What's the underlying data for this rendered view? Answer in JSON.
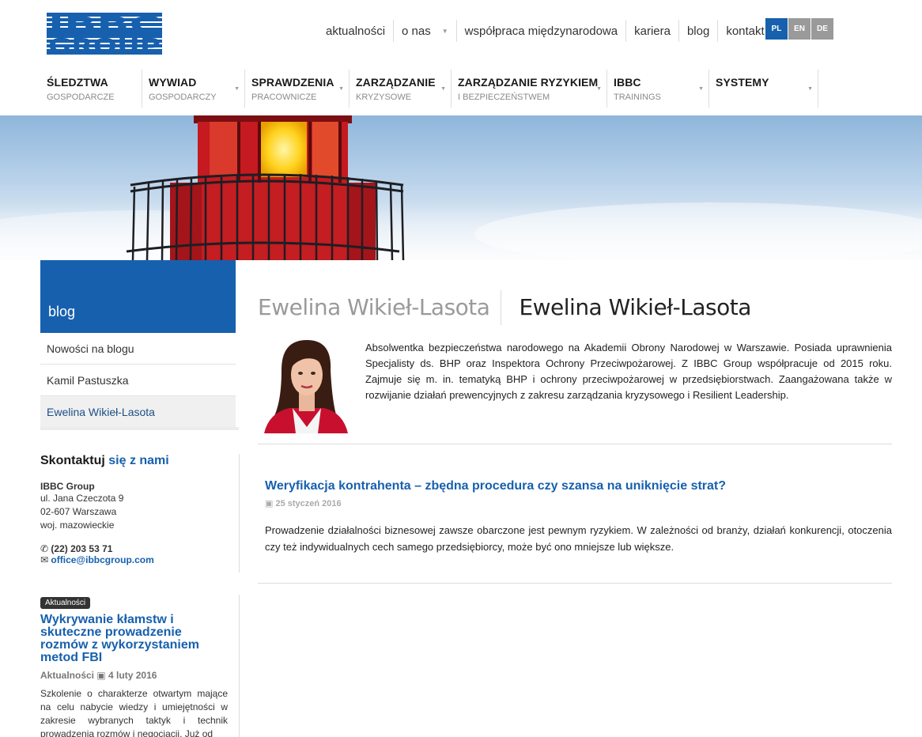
{
  "logo": {
    "text_top": "IBBC",
    "text_bottom": "GROUP",
    "color": "#1760ae"
  },
  "top_nav": [
    {
      "label": "aktualności",
      "caret": false
    },
    {
      "label": "o nas",
      "caret": true
    },
    {
      "label": "współpraca międzynarodowa",
      "caret": false
    },
    {
      "label": "kariera",
      "caret": false
    },
    {
      "label": "blog",
      "caret": false
    },
    {
      "label": "kontakt",
      "caret": false
    }
  ],
  "languages": [
    {
      "code": "PL",
      "active": true
    },
    {
      "code": "EN",
      "active": false
    },
    {
      "code": "DE",
      "active": false
    }
  ],
  "main_nav": [
    {
      "title": "ŚLEDZTWA",
      "subtitle": "GOSPODARCZE"
    },
    {
      "title": "WYWIAD",
      "subtitle": "GOSPODARCZY"
    },
    {
      "title": "SPRAWDZENIA",
      "subtitle": "PRACOWNICZE"
    },
    {
      "title": "ZARZĄDZANIE",
      "subtitle": "KRYZYSOWE"
    },
    {
      "title": "ZARZĄDZANIE RYZYKIEM",
      "subtitle": "I BEZPIECZEŃSTWEM"
    },
    {
      "title": "IBBC",
      "subtitle": "TRAININGS"
    },
    {
      "title": "SYSTEMY",
      "subtitle": ""
    }
  ],
  "sidebar": {
    "heading": "blog",
    "items": [
      {
        "label": "Nowości na blogu",
        "active": false
      },
      {
        "label": "Kamil Pastuszka",
        "active": false
      },
      {
        "label": "Ewelina Wikieł-Lasota",
        "active": true
      }
    ],
    "contact": {
      "heading_a": "Skontaktuj",
      "heading_b": "się z nami",
      "org": "IBBC Group",
      "street": "ul. Jana Czeczota 9",
      "city": "02-607 Warszawa",
      "region": "woj. mazowieckie",
      "phone": "(22) 203 53 71",
      "email": "office@ibbcgroup.com"
    },
    "news": {
      "badge": "Aktualności",
      "title": "Wykrywanie kłamstw i skuteczne prowadzenie rozmów z wykorzystaniem metod FBI",
      "category": "Aktualności",
      "date": "4 luty 2016",
      "excerpt": "Szkolenie o charakterze otwartym mające na celu nabycie wiedzy i umiejętności w zakresie wybranych taktyk i technik prowadzenia rozmów i negocjacji. Już od"
    }
  },
  "page": {
    "breadcrumb_title": "Ewelina Wikieł-Lasota",
    "title": "Ewelina Wikieł-Lasota",
    "bio": "Absolwentka bezpieczeństwa narodowego na Akademii Obrony Narodowej w Warszawie. Posiada uprawnienia Specjalisty ds. BHP oraz Inspektora Ochrony Przeciwpożarowej. Z IBBC Group współpracuje od 2015 roku. Zajmuje się m. in. tematyką BHP i ochrony przeciwpożarowej w przedsiębiorstwach. Zaangażowana także w rozwijanie działań prewencyjnych z zakresu zarządzania kryzysowego i Resilient Leadership.",
    "post": {
      "title": "Weryfikacja kontrahenta – zbędna procedura czy szansa na uniknięcie strat?",
      "date": "25 styczeń 2016",
      "excerpt": "Prowadzenie działalności biznesowej zawsze obarczone jest pewnym ryzykiem. W zależności od branży, działań konkurencji, otoczenia czy też indywidualnych cech samego przedsiębiorcy, może być ono mniejsze lub większe."
    }
  }
}
